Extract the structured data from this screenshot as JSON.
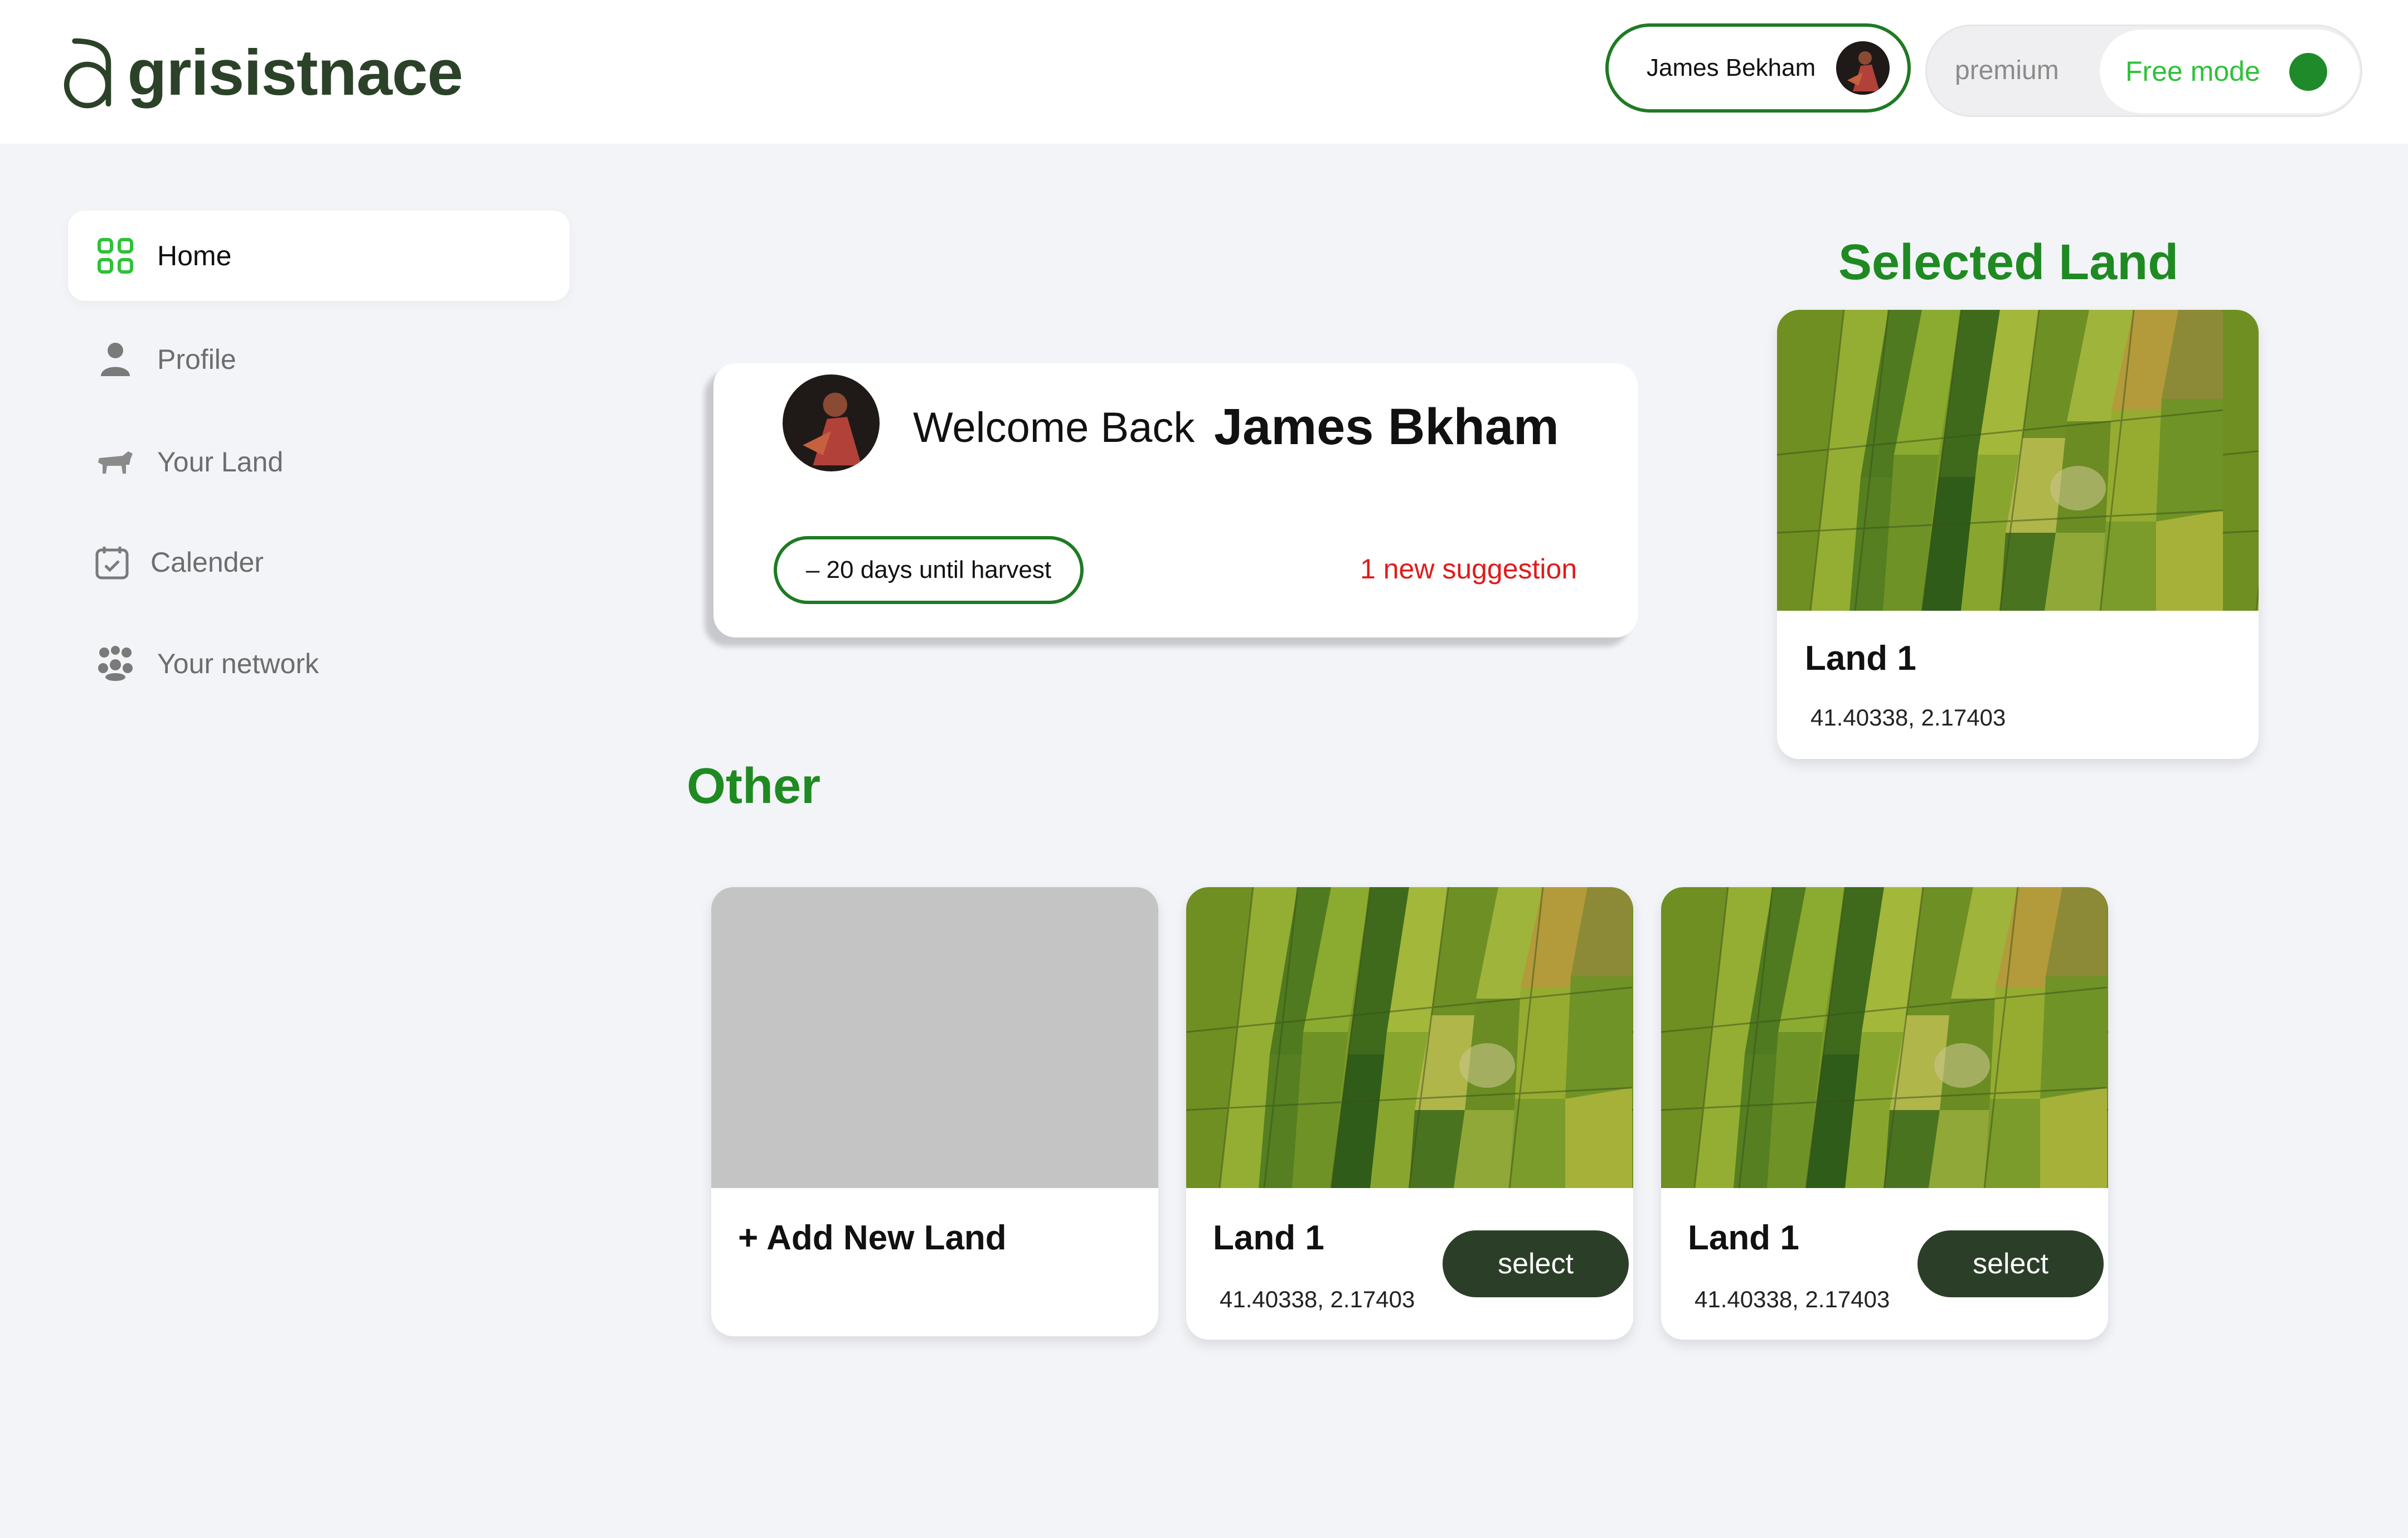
{
  "brand": {
    "name": "grisistnace"
  },
  "header": {
    "user_name": "James Bekham",
    "modes": {
      "premium": "premium",
      "free": "Free mode"
    }
  },
  "sidebar": {
    "items": [
      {
        "label": "Home",
        "icon": "grid-icon",
        "active": true
      },
      {
        "label": "Profile",
        "icon": "user-icon",
        "active": false
      },
      {
        "label": "Your Land",
        "icon": "cow-icon",
        "active": false
      },
      {
        "label": "Calender",
        "icon": "calendar-icon",
        "active": false
      },
      {
        "label": "Your network",
        "icon": "network-icon",
        "active": false
      }
    ]
  },
  "welcome": {
    "greeting": "Welcome Back",
    "name": "James Bkham",
    "harvest": "– 20 days until harvest",
    "suggestion": "1 new suggestion"
  },
  "selected_land": {
    "title": "Selected Land",
    "name": "Land 1",
    "coords": "41.40338, 2.17403"
  },
  "other": {
    "title": "Other",
    "add_label": "+ Add New Land",
    "lands": [
      {
        "name": "Land 1",
        "coords": "41.40338, 2.17403",
        "action": "select"
      },
      {
        "name": "Land 1",
        "coords": "41.40338, 2.17403",
        "action": "select"
      }
    ]
  },
  "colors": {
    "accent_green": "#1f8a22",
    "dark_green": "#2b3f28",
    "alert_red": "#e01b1b",
    "free_mode_green": "#2ec13a"
  }
}
